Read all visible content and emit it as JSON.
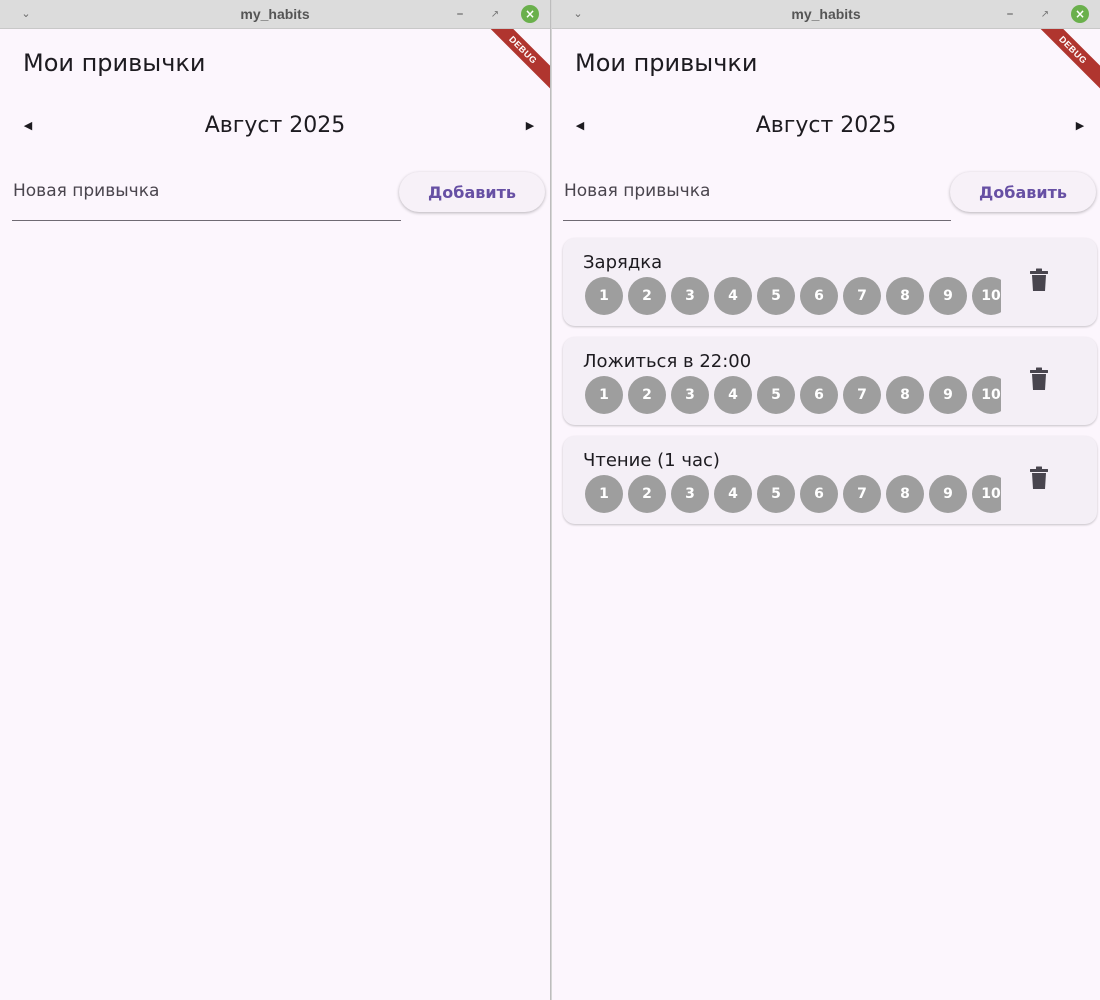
{
  "colors": {
    "background": "#fcf6fd",
    "accent": "#6750a4",
    "card": "#f4eff6",
    "day_dot": "#9e9e9e",
    "debug_ribbon": "#b0352f",
    "close_button": "#6ab04c"
  },
  "icons": {
    "window_menu": "chevron-down-icon",
    "minimize": "minimize-icon",
    "maximize": "restore-icon",
    "close": "close-icon",
    "previous_month": "arrow-left-icon",
    "next_month": "arrow-right-icon",
    "delete": "trash-icon"
  },
  "window_left": {
    "title": "my_habits",
    "debug_label": "DEBUG",
    "app_title": "Мои привычки",
    "month": "Август 2025",
    "input_placeholder": "Новая привычка",
    "add_label": "Добавить",
    "habits": []
  },
  "window_right": {
    "title": "my_habits",
    "debug_label": "DEBUG",
    "app_title": "Мои привычки",
    "month": "Август 2025",
    "input_placeholder": "Новая привычка",
    "add_label": "Добавить",
    "habits": [
      {
        "name": "Зарядка",
        "days": [
          "1",
          "2",
          "3",
          "4",
          "5",
          "6",
          "7",
          "8",
          "9",
          "10"
        ]
      },
      {
        "name": "Ложиться в 22:00",
        "days": [
          "1",
          "2",
          "3",
          "4",
          "5",
          "6",
          "7",
          "8",
          "9",
          "10"
        ]
      },
      {
        "name": "Чтение (1 час)",
        "days": [
          "1",
          "2",
          "3",
          "4",
          "5",
          "6",
          "7",
          "8",
          "9",
          "10"
        ]
      }
    ]
  }
}
